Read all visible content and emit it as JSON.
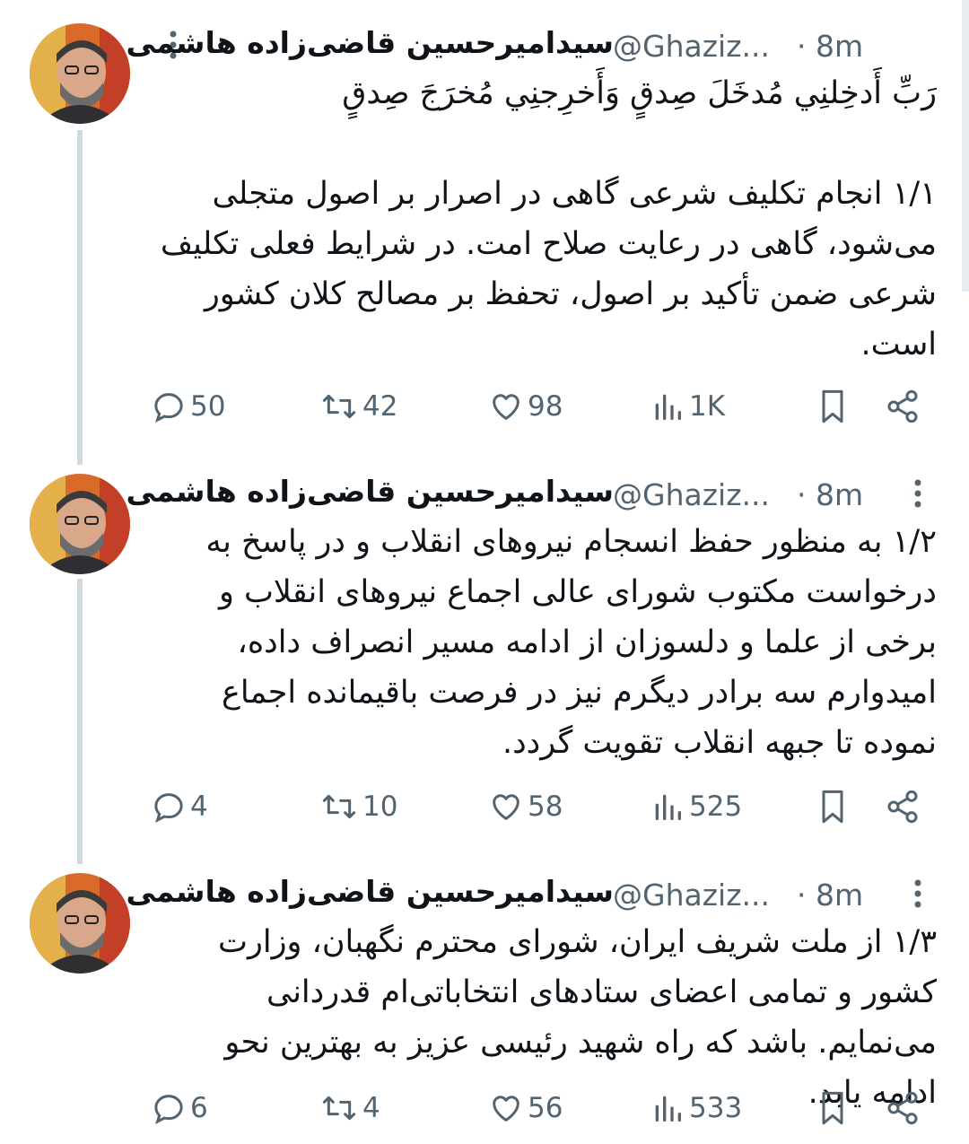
{
  "tweets": [
    {
      "author": "سیدامیرحسین قاضی‌زاده هاشمی",
      "handle": "@Ghaziz...",
      "time": "· 8m",
      "text": "رَبِّ أَدخِلنِي مُدخَلَ صِدقٍ وَأَخرِجنِي مُخرَجَ صِدقٍ\n\n۱/۱ انجام تکلیف شرعی گاهی در اصرار بر اصول متجلی می‌شود، گاهی در رعایت صلاح امت. در شرایط فعلی تکلیف شرعی ضمن تأکید بر اصول، تحفظ بر مصالح کلان کشور است.",
      "replies": "50",
      "retweets": "42",
      "likes": "98",
      "views": "1K"
    },
    {
      "author": "سیدامیرحسین قاضی‌زاده هاشمی",
      "handle": "@Ghaziz...",
      "time": "· 8m",
      "text": "۱/۲ به منظور حفظ انسجام نیروهای انقلاب و در پاسخ به درخواست مکتوب شورای عالی اجماع نیروهای انقلاب و برخی از علما و دلسوزان از ادامه مسیر انصراف داده، امیدوارم سه برادر دیگرم نیز در فرصت باقیمانده اجماع نموده تا جبهه انقلاب تقویت گردد.",
      "replies": "4",
      "retweets": "10",
      "likes": "58",
      "views": "525"
    },
    {
      "author": "سیدامیرحسین قاضی‌زاده هاشمی",
      "handle": "@Ghaziz...",
      "time": "· 8m",
      "text": "۱/۳ از ملت شریف ایران، شورای محترم نگهبان، وزارت کشور و تمامی اعضای ستادهای انتخاباتی‌ام قدردانی می‌نمایم. باشد که راه شهید رئیسی عزیز به بهترین نحو ادامه یابد.",
      "replies": "6",
      "retweets": "4",
      "likes": "56",
      "views": "533"
    }
  ],
  "colors": {
    "text": "#0f1419",
    "secondary": "#536471",
    "thread_line": "#cfd9de",
    "background": "#ffffff"
  },
  "icons": [
    "more-icon",
    "reply-icon",
    "retweet-icon",
    "like-icon",
    "views-icon",
    "bookmark-icon",
    "share-icon"
  ]
}
